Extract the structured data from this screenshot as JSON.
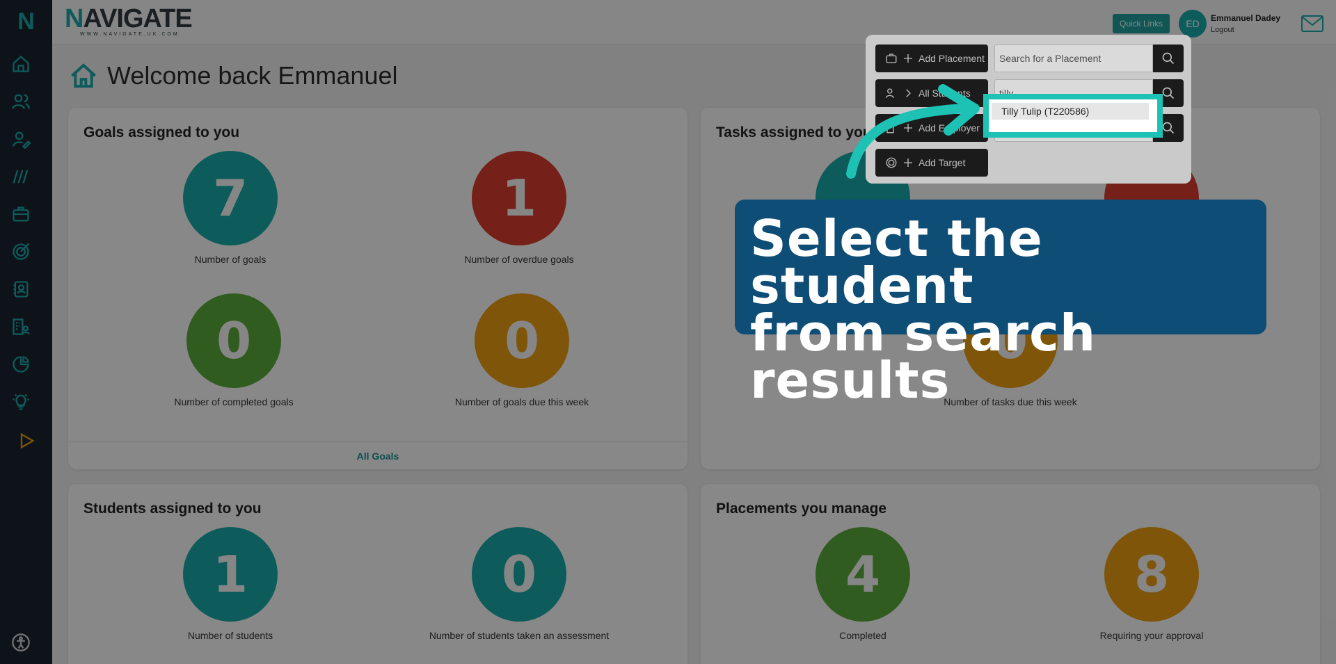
{
  "brand": {
    "name_n": "N",
    "name_rest": "AVIGATE",
    "url": "WWW.NAVIGATE.UK.COM",
    "sidebar_logo": "N"
  },
  "header": {
    "quick_links": "Quick Links",
    "avatar_initials": "ED",
    "user_name": "Emmanuel Dadey",
    "logout": "Logout"
  },
  "welcome": {
    "text": "Welcome back Emmanuel"
  },
  "goals": {
    "title": "Goals assigned to you",
    "stats": [
      {
        "value": "7",
        "label": "Number of goals"
      },
      {
        "value": "1",
        "label": "Number of overdue goals"
      },
      {
        "value": "0",
        "label": "Number of completed goals"
      },
      {
        "value": "0",
        "label": "Number of goals due this week"
      }
    ],
    "footer": "All Goals"
  },
  "tasks": {
    "title": "Tasks assigned to you",
    "stats": [
      {
        "value": "0",
        "label": "Number of tasks due this week"
      }
    ]
  },
  "students": {
    "title": "Students assigned to you",
    "stats": [
      {
        "value": "1",
        "label": "Number of students"
      },
      {
        "value": "0",
        "label": "Number of students taken an assessment"
      }
    ]
  },
  "placements": {
    "title": "Placements you manage",
    "stats": [
      {
        "value": "4",
        "label": "Completed"
      },
      {
        "value": "8",
        "label": "Requiring your approval"
      }
    ]
  },
  "quick_panel": {
    "add_placement": "Add Placement",
    "all_students": "All Students",
    "add_employer": "Add Employer",
    "add_target": "Add Target",
    "placement_search_placeholder": "Search for a Placement",
    "student_search_value": "tilly"
  },
  "search_result": {
    "item": "Tilly Tulip (T220586)"
  },
  "callout": {
    "line1": "Select the student",
    "line2": "from search results"
  },
  "colors": {
    "teal": "#1aa6a6",
    "red": "#d63b2f",
    "green": "#5aa83a",
    "orange": "#e59b12",
    "callout_bg": "#0e4d76",
    "highlight": "#1ec2b4"
  }
}
